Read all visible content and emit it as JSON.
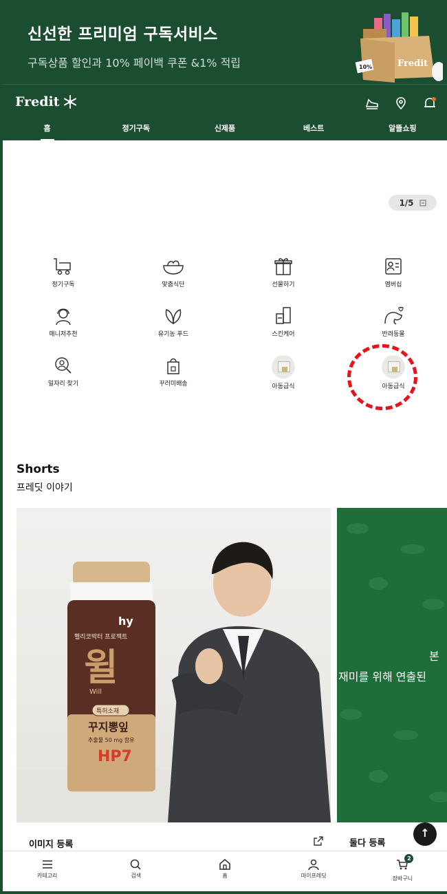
{
  "promo": {
    "title": "신선한 프리미엄 구독서비스",
    "subtitle": "구독상품 할인과 10% 페이백 쿠폰 &1% 적립",
    "box_brand": "Fredit",
    "box_tag": "10%"
  },
  "header": {
    "logo": "Fredit",
    "tabs": [
      "홈",
      "정기구독",
      "신제품",
      "베스트",
      "알뜰쇼핑"
    ],
    "active_tab": 0
  },
  "hero": {
    "pager": "1/5"
  },
  "categories": [
    {
      "label": "정기구독",
      "icon": "delivery-cart-icon"
    },
    {
      "label": "맞춤식단",
      "icon": "salad-bowl-icon"
    },
    {
      "label": "선물하기",
      "icon": "gift-icon"
    },
    {
      "label": "멤버십",
      "icon": "member-card-icon"
    },
    {
      "label": "매니저추천",
      "icon": "manager-icon"
    },
    {
      "label": "유기농 푸드",
      "icon": "leaf-icon"
    },
    {
      "label": "스킨케어",
      "icon": "skincare-icon"
    },
    {
      "label": "반려동물",
      "icon": "pet-icon"
    },
    {
      "label": "일자리 찾기",
      "icon": "job-search-icon"
    },
    {
      "label": "꾸러미배송",
      "icon": "package-bag-icon"
    },
    {
      "label": "아동급식",
      "icon": "child-meal-thumb"
    },
    {
      "label": "아동급식",
      "icon": "child-meal-thumb"
    }
  ],
  "shorts": {
    "title": "Shorts",
    "subtitle": "프레딧 이야기",
    "cards": [
      {
        "label": "이미지 등록",
        "product": {
          "brand": "hy",
          "line": "헬리코박터 프로젝트",
          "name": "윌",
          "name_en": "Will",
          "badge": "특허소재",
          "ingredient": "꾸지뽕잎",
          "amount": "추출물 50 mg 함유",
          "strain": "HP7"
        }
      },
      {
        "label": "둘다 등록",
        "text_line1": "본",
        "text_line2": "재미를 위해 연출된"
      }
    ]
  },
  "bottom_nav": [
    {
      "label": "카테고리",
      "icon": "menu-icon"
    },
    {
      "label": "검색",
      "icon": "search-icon"
    },
    {
      "label": "홈",
      "icon": "home-icon"
    },
    {
      "label": "마이프레딧",
      "icon": "user-icon"
    },
    {
      "label": "장바구니",
      "icon": "cart-icon",
      "badge": "2"
    }
  ],
  "colors": {
    "brand": "#1b4d31",
    "accent_red": "#e8121a",
    "card2_bg": "#1f6e3a"
  }
}
